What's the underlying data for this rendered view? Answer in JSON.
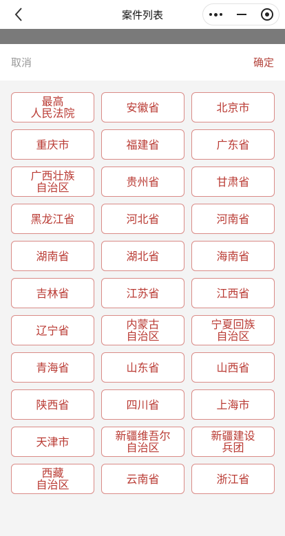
{
  "navbar": {
    "title": "案件列表",
    "back_icon": "chevron-left-icon"
  },
  "capsule": {
    "more_icon": "more-dots-icon",
    "minimize_icon": "minus-icon",
    "close_icon": "target-circle-icon"
  },
  "picker": {
    "cancel_label": "取消",
    "confirm_label": "确定"
  },
  "provinces": [
    "最高\n人民法院",
    "安徽省",
    "北京市",
    "重庆市",
    "福建省",
    "广东省",
    "广西壮族\n自治区",
    "贵州省",
    "甘肃省",
    "黑龙江省",
    "河北省",
    "河南省",
    "湖南省",
    "湖北省",
    "海南省",
    "吉林省",
    "江苏省",
    "江西省",
    "辽宁省",
    "内蒙古\n自治区",
    "宁夏回族\n自治区",
    "青海省",
    "山东省",
    "山西省",
    "陕西省",
    "四川省",
    "上海市",
    "天津市",
    "新疆维吾尔\n自治区",
    "新疆建设\n兵团",
    "西藏\n自治区",
    "云南省",
    "浙江省"
  ],
  "colors": {
    "accent": "#b93a33",
    "border": "#d98a86",
    "background": "#f4f4f4"
  }
}
